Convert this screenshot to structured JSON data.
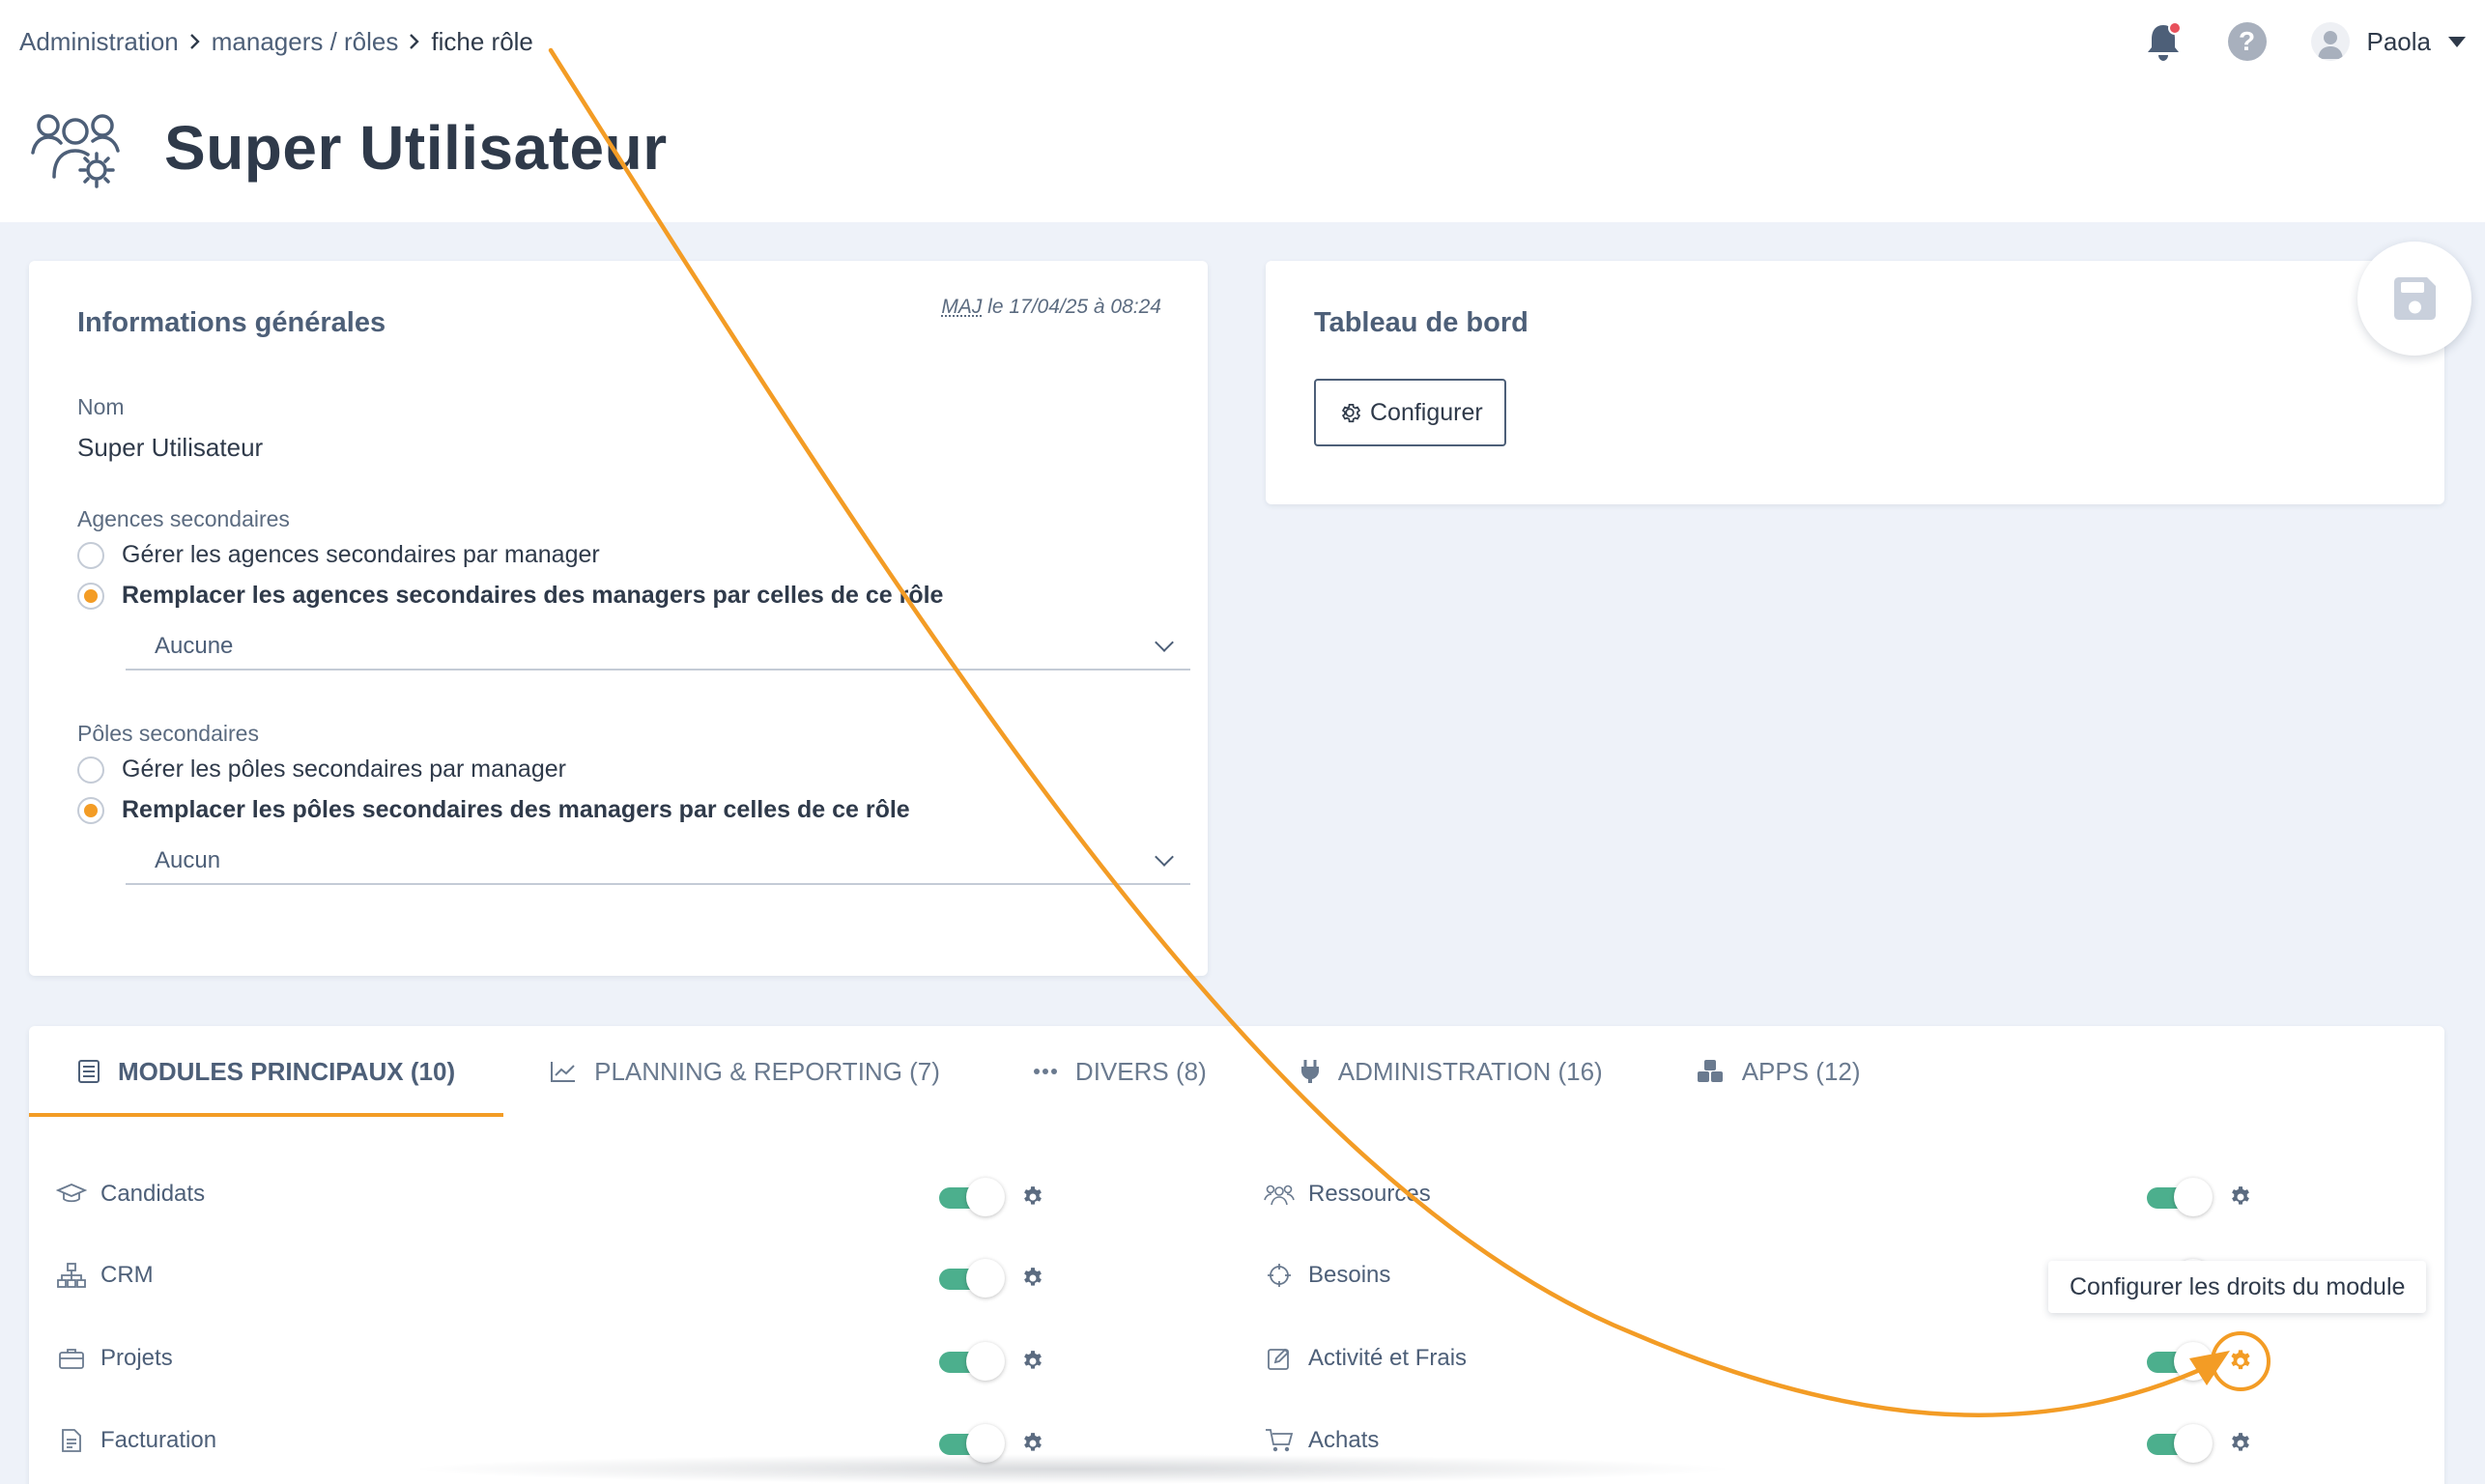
{
  "breadcrumb": {
    "items": [
      "Administration",
      "managers / rôles",
      "fiche rôle"
    ]
  },
  "header": {
    "title": "Super Utilisateur",
    "user_name": "Paola",
    "help_label": "?"
  },
  "info_card": {
    "title": "Informations générales",
    "updated_abbr": "MAJ",
    "updated_rest": " le 17/04/25 à 08:24",
    "name_label": "Nom",
    "name_value": "Super Utilisateur",
    "agences": {
      "label": "Agences secondaires",
      "option_1": "Gérer les agences secondaires par manager",
      "option_2": "Remplacer les agences secondaires des managers par celles de ce rôle",
      "selected_value": "Aucune"
    },
    "poles": {
      "label": "Pôles secondaires",
      "option_1": "Gérer les pôles secondaires par manager",
      "option_2": "Remplacer les pôles secondaires des managers par celles de ce rôle",
      "selected_value": "Aucun"
    }
  },
  "dashboard_card": {
    "title": "Tableau de bord",
    "configure_label": "Configurer"
  },
  "tabs": [
    {
      "label": "MODULES PRINCIPAUX (10)"
    },
    {
      "label": "PLANNING & REPORTING (7)"
    },
    {
      "label": "DIVERS (8)"
    },
    {
      "label": "ADMINISTRATION (16)"
    },
    {
      "label": "APPS (12)"
    }
  ],
  "modules_left": [
    {
      "label": "Candidats",
      "enabled": true
    },
    {
      "label": "CRM",
      "enabled": true
    },
    {
      "label": "Projets",
      "enabled": true
    },
    {
      "label": "Facturation",
      "enabled": true
    }
  ],
  "modules_right": [
    {
      "label": "Ressources",
      "enabled": true
    },
    {
      "label": "Besoins",
      "enabled": true
    },
    {
      "label": "Activité et Frais",
      "enabled": true
    },
    {
      "label": "Achats",
      "enabled": true
    }
  ],
  "tooltip": {
    "text": "Configurer les droits du module"
  },
  "colors": {
    "accent": "#f39c25",
    "toggle_on": "#4caf8d",
    "text_primary": "#2f3a4a",
    "text_secondary": "#4d5f78",
    "notification_dot": "#e8505b"
  }
}
